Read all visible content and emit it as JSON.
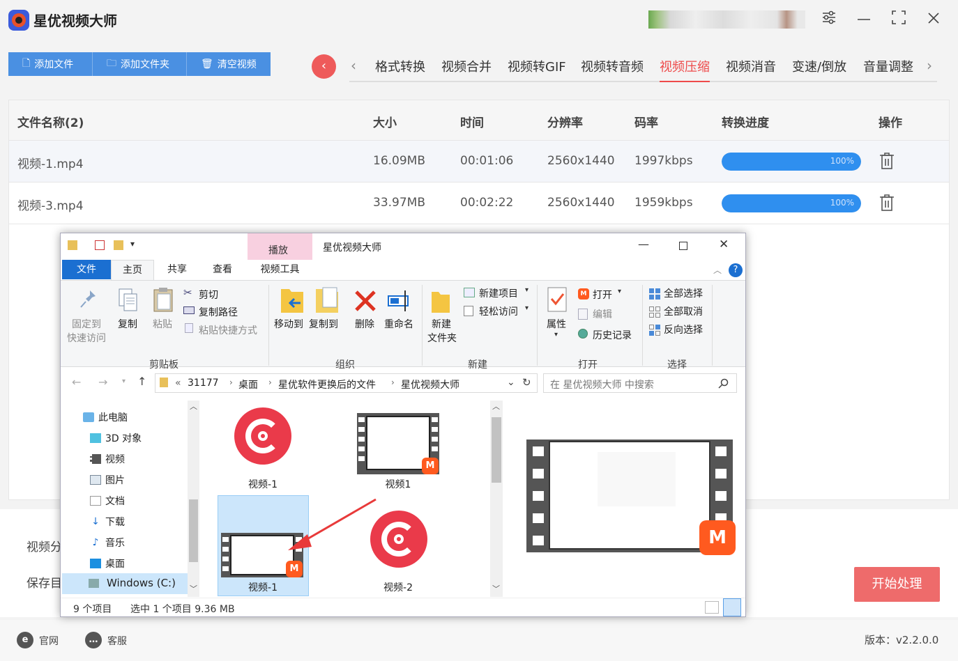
{
  "app": {
    "title": "星优视频大师"
  },
  "window_controls": {
    "settings": "⚙",
    "minimize": "—",
    "maximize": "⛶",
    "close": "✕"
  },
  "toolbar": {
    "add_file": "添加文件",
    "add_folder": "添加文件夹",
    "clear": "清空视频"
  },
  "tabs": [
    "格式转换",
    "视频合并",
    "视频转GIF",
    "视频转音频",
    "视频压缩",
    "视频消音",
    "变速/倒放",
    "音量调整"
  ],
  "active_tab": "视频压缩",
  "table": {
    "headers": [
      "文件名称(2)",
      "大小",
      "时间",
      "分辨率",
      "码率",
      "转换进度",
      "操作"
    ],
    "rows": [
      {
        "name": "视频-1.mp4",
        "size": "16.09MB",
        "time": "00:01:06",
        "resolution": "2560x1440",
        "bitrate": "1997kbps",
        "progress": 1.0,
        "progress_label": "100%"
      },
      {
        "name": "视频-3.mp4",
        "size": "33.97MB",
        "time": "00:02:22",
        "resolution": "2560x1440",
        "bitrate": "1959kbps",
        "progress": 1.0,
        "progress_label": "100%"
      }
    ]
  },
  "bottom": {
    "label1": "视频分",
    "label2": "保存目",
    "start": "开始处理"
  },
  "footer": {
    "site": "官网",
    "service": "客服",
    "version": "版本：v2.2.0.0"
  },
  "explorer": {
    "title": "星优视频大师",
    "play_tab": "播放",
    "ribbon_tabs": [
      "文件",
      "主页",
      "共享",
      "查看",
      "视频工具"
    ],
    "ribbon": {
      "pin": "固定到",
      "pin2": "快速访问",
      "copy": "复制",
      "paste": "粘贴",
      "cut": "剪切",
      "copy_path": "复制路径",
      "paste_shortcut": "粘贴快捷方式",
      "group_clipboard": "剪贴板",
      "move_to": "移动到",
      "copy_to": "复制到",
      "delete": "删除",
      "rename": "重命名",
      "group_organize": "组织",
      "new_folder": "新建",
      "new_folder2": "文件夹",
      "new_item": "新建项目",
      "easy_access": "轻松访问",
      "group_new": "新建",
      "properties": "属性",
      "open": "打开",
      "edit": "编辑",
      "history": "历史记录",
      "group_open": "打开",
      "select_all": "全部选择",
      "select_none": "全部取消",
      "invert": "反向选择",
      "group_select": "选择"
    },
    "address": [
      "«",
      "31177",
      "桌面",
      "星优软件更换后的文件",
      "星优视频大师"
    ],
    "search_placeholder": "在 星优视频大师 中搜索",
    "nav": [
      "此电脑",
      "3D 对象",
      "视频",
      "图片",
      "文档",
      "下载",
      "音乐",
      "桌面",
      "Windows (C:)"
    ],
    "files": [
      "视频-1",
      "视频1",
      "视频-1",
      "视频-2"
    ],
    "status": {
      "count": "9 个项目",
      "selected": "选中 1 个项目  9.36 MB"
    }
  },
  "colors": {
    "accent": "#ee4a4a",
    "primary": "#4a90e2",
    "progress": "#2f8fef"
  }
}
